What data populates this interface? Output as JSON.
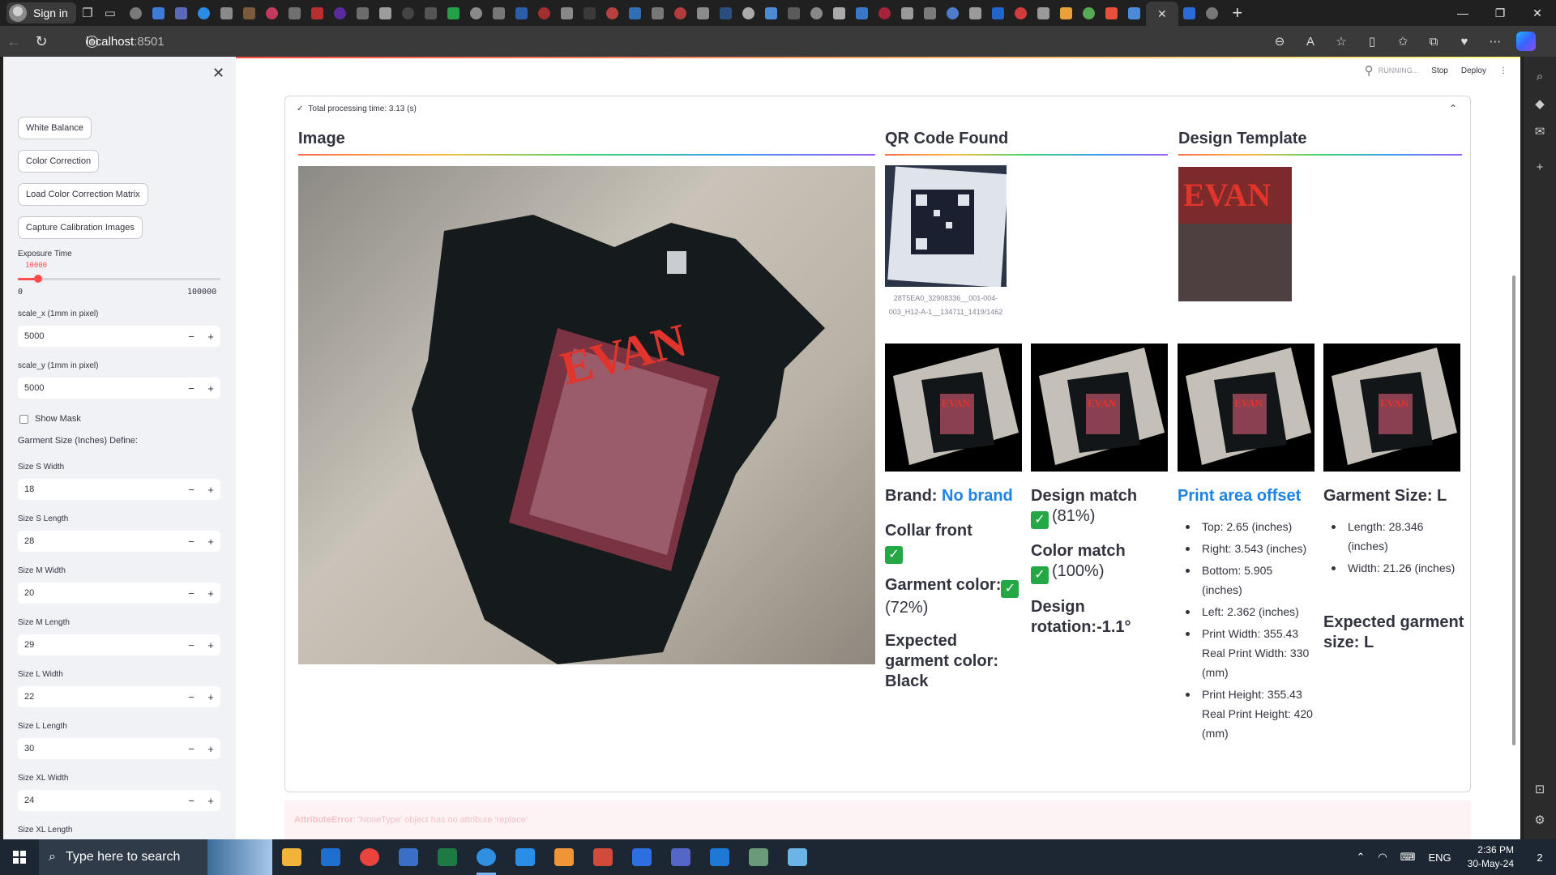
{
  "browser": {
    "profile_label": "Sign in",
    "url_host": "localhost",
    "url_port": ":8501",
    "tab_favicon_colors": [
      "#7a7a7a",
      "#3d7bd9",
      "#5a6ab8",
      "#2b8ce6",
      "#8a8a8a",
      "#7a5a3a",
      "#c23b5e",
      "#707070",
      "#b63030",
      "#5a2aa0",
      "#6c6c6c",
      "#9c9c9c",
      "#444",
      "#555",
      "#24a148",
      "#8a8a8a",
      "#777",
      "#2b5ea8",
      "#a03030",
      "#888",
      "#3a3a3a",
      "#b7413e",
      "#2f6fb5",
      "#777",
      "#b23c3c",
      "#8a8a8a",
      "#2a4e7d",
      "#aaa",
      "#4b8bd6",
      "#5a5a5a",
      "#888",
      "#aaa",
      "#3a77c9",
      "#a3243b",
      "#999",
      "#7a7a7a",
      "#4c7ccb",
      "#9a9a9a",
      "#2266cc",
      "#d33c3c",
      "#999",
      "#e9a23b",
      "#55aa55",
      "#e84e3c",
      "#4a8ad6"
    ]
  },
  "sidebar": {
    "buttons": [
      "White Balance",
      "Color Correction",
      "Load Color Correction Matrix",
      "Capture Calibration Images"
    ],
    "exposure": {
      "label": "Exposure Time",
      "value": "10000",
      "min": "0",
      "max": "100000",
      "fraction": 0.1
    },
    "inputs": [
      {
        "label": "scale_x (1mm in pixel)",
        "value": "5000"
      },
      {
        "label": "scale_y (1mm in pixel)",
        "value": "5000"
      }
    ],
    "show_mask_label": "Show Mask",
    "garment_header": "Garment Size (Inches) Define:",
    "size_inputs": [
      {
        "label": "Size S Width",
        "value": "18"
      },
      {
        "label": "Size S Length",
        "value": "28"
      },
      {
        "label": "Size M Width",
        "value": "20"
      },
      {
        "label": "Size M Length",
        "value": "29"
      },
      {
        "label": "Size L Width",
        "value": "22"
      },
      {
        "label": "Size L Length",
        "value": "30"
      },
      {
        "label": "Size XL Width",
        "value": "24"
      },
      {
        "label": "Size XL Length",
        "value": ""
      }
    ]
  },
  "header": {
    "status": "RUNNING...",
    "stop": "Stop",
    "deploy": "Deploy"
  },
  "main": {
    "processing_time": "Total processing time: 3.13 (s)",
    "col_image": "Image",
    "col_qr": "QR Code Found",
    "col_template": "Design Template",
    "qr_caption": "28T5EA0_32908336__001-004-003_H12-A-1__134711_1419/1462",
    "brand_label": "Brand: ",
    "brand_value": "No brand",
    "collar": "Collar front",
    "garment_color_label": "Garment color:",
    "garment_color_pct": "(72%)",
    "expected_color": "Expected garment color: Black",
    "design_match_label": "Design match",
    "design_match_pct": "(81%)",
    "color_match_label": "Color match",
    "color_match_pct": "(100%)",
    "design_rotation": "Design rotation:-1.1°",
    "print_offset_title": "Print area offset",
    "print_offset_items": [
      "Top: 2.65 (inches)",
      "Right: 3.543 (inches)",
      "Bottom: 5.905 (inches)",
      "Left: 2.362 (inches)",
      "Print Width: 355.43 Real Print Width: 330 (mm)",
      "Print Height: 355.43 Real Print Height: 420 (mm)"
    ],
    "garment_size_title": "Garment Size: L",
    "garment_size_items": [
      "Length: 28.346 (inches)",
      "Width: 21.26 (inches)"
    ],
    "expected_size": "Expected garment size: L",
    "check_glyph": "✓",
    "error_type": "AttributeError",
    "error_msg": ": 'NoneType' object has no attribute 'replace'"
  },
  "taskbar": {
    "search_placeholder": "Type here to search",
    "app_colors": [
      "#f0b43a",
      "#1f6fd1",
      "#e9443b",
      "#3b6fc7",
      "#1d7a43",
      "#2f8fe0",
      "#2a8de8",
      "#f09537",
      "#d24a3a",
      "#2d6fe0",
      "#5466c7",
      "#1e79d6",
      "#6a9a7a",
      "#6bb4e8"
    ],
    "lang": "ENG",
    "time": "2:36 PM",
    "date": "30-May-24",
    "notif_count": "2"
  }
}
